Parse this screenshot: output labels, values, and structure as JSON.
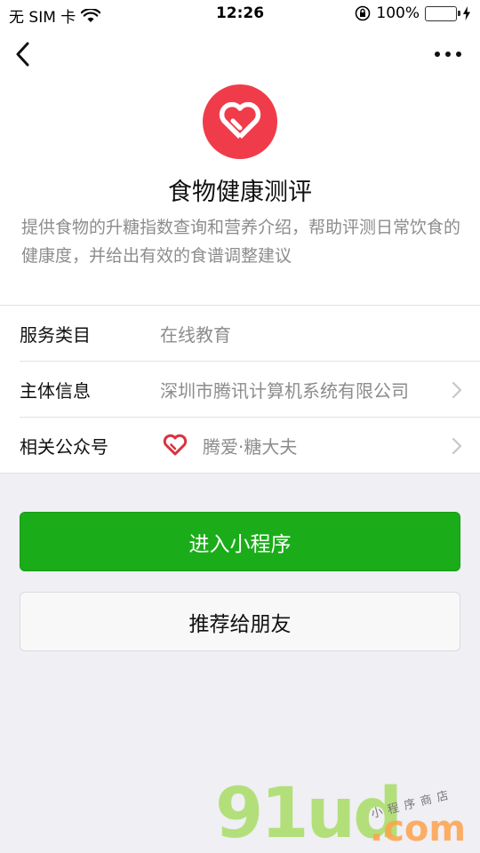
{
  "status_bar": {
    "carrier": "无 SIM 卡",
    "time": "12:26",
    "battery_percent": "100%",
    "battery_level": 1.0,
    "icons": [
      "wifi-icon",
      "orientation-lock-icon",
      "battery-icon",
      "charging-icon"
    ]
  },
  "nav": {
    "back_icon": "chevron-left-icon",
    "more_icon": "more-dots-icon"
  },
  "app": {
    "logo_icon": "heart-icon",
    "logo_color": "#f03c4a",
    "name": "食物健康测评",
    "description": "提供食物的升糖指数查询和营养介绍，帮助评测日常饮食的健康度，并给出有效的食谱调整建议"
  },
  "info": {
    "category": {
      "label": "服务类目",
      "value": "在线教育"
    },
    "entity": {
      "label": "主体信息",
      "value": "深圳市腾讯计算机系统有限公司"
    },
    "official_account": {
      "label": "相关公众号",
      "value": "腾爱·糖大夫",
      "icon": "heart-outline-icon"
    }
  },
  "actions": {
    "enter_label": "进入小程序",
    "share_label": "推荐给朋友",
    "primary_color": "#1aad19"
  },
  "watermark": {
    "main": "91ud",
    "suffix": ".com",
    "script": "小程序商店"
  }
}
